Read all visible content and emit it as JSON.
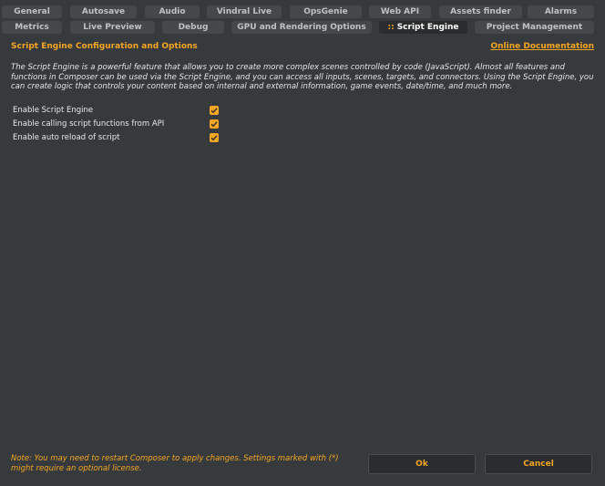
{
  "tabs_row1": [
    {
      "label": "General"
    },
    {
      "label": "Autosave"
    },
    {
      "label": "Audio"
    },
    {
      "label": "Vindral Live"
    },
    {
      "label": "OpsGenie"
    },
    {
      "label": "Web API"
    },
    {
      "label": "Assets finder"
    },
    {
      "label": "Alarms"
    }
  ],
  "tabs_row2": [
    {
      "label": "Metrics"
    },
    {
      "label": "Live Preview"
    },
    {
      "label": "Debug"
    },
    {
      "label": "GPU and Rendering Options"
    },
    {
      "label": "Script Engine",
      "marker": "::",
      "active": true
    },
    {
      "label": "Project Management"
    }
  ],
  "section": {
    "title": "Script Engine Configuration and Options",
    "doc_link": "Online Documentation",
    "description": "The Script Engine is a powerful feature that allows you to create more complex scenes controlled by code (JavaScript). Almost all features and functions in Composer can be used via the Script Engine, and you can access all inputs, scenes, targets, and connectors. Using the Script Engine, you can create logic that controls your content based on internal and external information, game events, date/time, and much more."
  },
  "options": [
    {
      "label": "Enable Script Engine",
      "checked": true
    },
    {
      "label": "Enable calling script functions from API",
      "checked": true
    },
    {
      "label": "Enable auto reload of script",
      "checked": true
    }
  ],
  "footer": {
    "note": "Note: You may need to restart Composer to apply changes. Settings marked with (*) might require an optional license.",
    "ok_label": "Ok",
    "cancel_label": "Cancel"
  },
  "colors": {
    "accent": "#f5a623",
    "background": "#373a3c",
    "tab": "#454849",
    "active_tab": "#2a2c2d"
  }
}
